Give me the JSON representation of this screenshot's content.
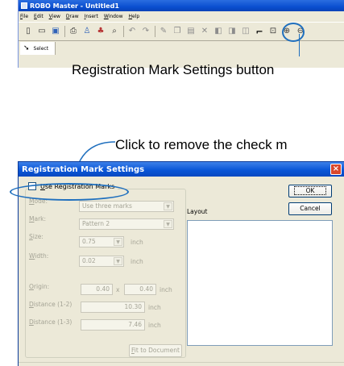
{
  "app": {
    "title": "ROBO Master - Untitled1",
    "menu": [
      "File",
      "Edit",
      "View",
      "Draw",
      "Insert",
      "Window",
      "Help"
    ],
    "select_tool_label": "Select"
  },
  "callouts": {
    "registration_button": "Registration Mark Settings button",
    "remove_check": "Click to remove the check m"
  },
  "dialog": {
    "title": "Registration Mark Settings",
    "use_registration_label": "Use Registration Marks",
    "mode_label": "Mode:",
    "mode_value": "Use three marks",
    "mark_label": "Mark:",
    "mark_value": "Pattern 2",
    "size_label": "Size:",
    "size_value": "0.75",
    "width_label": "Width:",
    "width_value": "0.02",
    "origin_label": "Origin:",
    "origin_x": "0.40",
    "origin_sep": "x",
    "origin_y": "0.40",
    "distance12_label": "Distance (1-2)",
    "distance12_value": "10.30",
    "distance13_label": "Distance (1-3)",
    "distance13_value": "7.46",
    "unit": "inch",
    "fit_button": "Fit to Document",
    "layout_label": "Layout",
    "ok_button": "OK",
    "cancel_button": "Cancel",
    "close_glyph": "×"
  },
  "icons": [
    "new-icon",
    "open-icon",
    "save-icon",
    "print-icon",
    "cut-plotter-icon",
    "cutter-icon",
    "preview-icon",
    "undo-icon",
    "redo-icon",
    "draw-icon",
    "copy-icon",
    "paste-icon",
    "delete-icon",
    "group-icon",
    "ungroup-icon",
    "weld-icon",
    "registration-mark-icon",
    "fit-icon",
    "zoom-in-icon",
    "zoom-out-icon"
  ],
  "colors": {
    "accent": "#1f6fbe",
    "titlebar": "#0a56d8",
    "dialog_bg": "#ece9d8"
  }
}
